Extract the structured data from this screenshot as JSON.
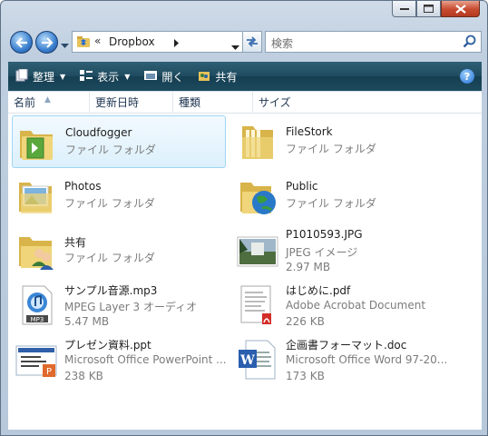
{
  "window": {
    "address": {
      "chevron": "«",
      "location": "Dropbox"
    },
    "search": {
      "placeholder": "検索"
    }
  },
  "toolbar": {
    "organize": "整理",
    "view": "表示",
    "open": "開く",
    "share": "共有",
    "help": "?"
  },
  "columns": [
    "名前",
    "更新日時",
    "種類",
    "サイズ"
  ],
  "items": [
    {
      "name": "Cloudfogger",
      "type": "ファイル フォルダ",
      "size": "",
      "icon": "cloudfogger-folder-icon"
    },
    {
      "name": "FileStork",
      "type": "ファイル フォルダ",
      "size": "",
      "icon": "folder-icon"
    },
    {
      "name": "Photos",
      "type": "ファイル フォルダ",
      "size": "",
      "icon": "photos-folder-icon"
    },
    {
      "name": "Public",
      "type": "ファイル フォルダ",
      "size": "",
      "icon": "public-folder-icon"
    },
    {
      "name": "共有",
      "type": "ファイル フォルダ",
      "size": "",
      "icon": "shared-folder-icon"
    },
    {
      "name": "P1010593.JPG",
      "type": "JPEG イメージ",
      "size": "2.97 MB",
      "icon": "jpeg-thumbnail-icon"
    },
    {
      "name": "サンプル音源.mp3",
      "type": "MPEG Layer 3 オーディオ",
      "size": "5.47 MB",
      "icon": "mp3-icon"
    },
    {
      "name": "はじめに.pdf",
      "type": "Adobe Acrobat Document",
      "size": "226 KB",
      "icon": "pdf-icon"
    },
    {
      "name": "プレゼン資料.ppt",
      "type": "Microsoft Office PowerPoint ...",
      "size": "238 KB",
      "icon": "ppt-icon"
    },
    {
      "name": "企画書フォーマット.doc",
      "type": "Microsoft Office Word 97-20...",
      "size": "173 KB",
      "icon": "doc-icon"
    }
  ],
  "colors": {
    "selection": "#dcf0fc",
    "toolbar": "#1f4b60"
  }
}
